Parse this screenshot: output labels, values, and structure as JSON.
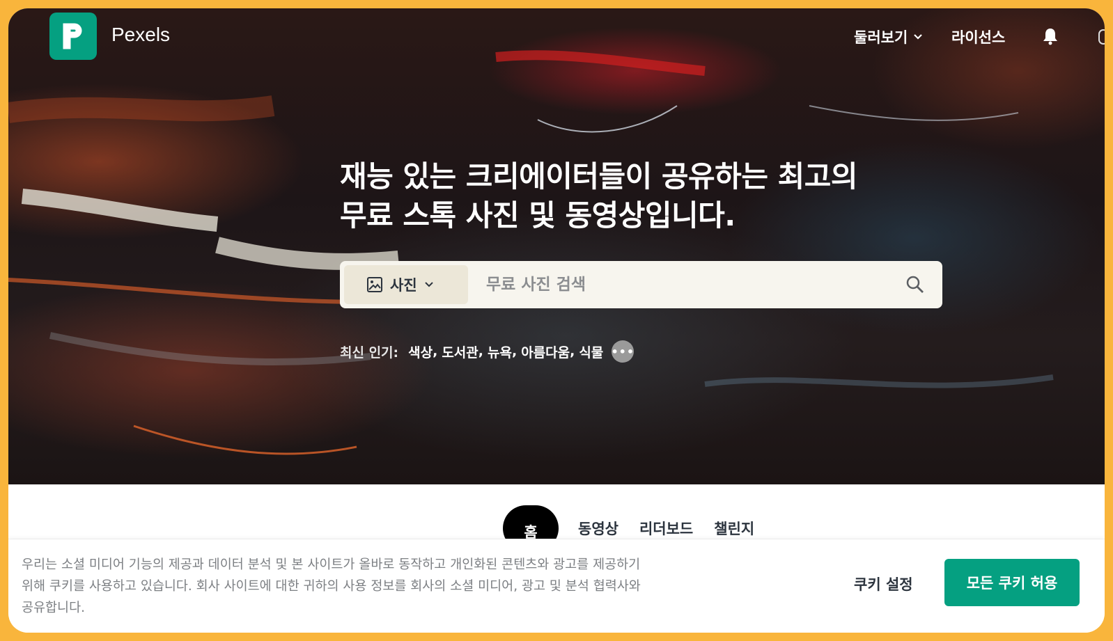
{
  "brand": {
    "name": "Pexels",
    "color": "#05a081"
  },
  "nav": {
    "explore_label": "둘러보기",
    "license_label": "라이선스",
    "icons": [
      "chevron-down-icon",
      "bell-icon"
    ]
  },
  "hero": {
    "headline_line1": "재능 있는 크리에이터들이 공유하는 최고의",
    "headline_line2": "무료 스톡 사진 및 동영상입니다."
  },
  "search": {
    "type_label": "사진",
    "placeholder": "무료 사진 검색",
    "value": ""
  },
  "trending": {
    "label": "최신 인기:",
    "items": [
      "색상",
      "도서관",
      "뉴욕",
      "아름다움",
      "식물"
    ],
    "more_label": "•••"
  },
  "tabs": [
    {
      "label": "홈",
      "active": true
    },
    {
      "label": "동영상",
      "active": false
    },
    {
      "label": "리더보드",
      "active": false
    },
    {
      "label": "챌린지",
      "active": false
    }
  ],
  "cookie_banner": {
    "text": "우리는 소셜 미디어 기능의 제공과 데이터 분석 및 본 사이트가 올바로 동작하고 개인화된 콘텐츠와 광고를 제공하기 위해 쿠키를 사용하고 있습니다. 회사 사이트에 대한 귀하의 사용 정보를 회사의 소셜 미디어, 광고 및 분석 협력사와 공유합니다.",
    "settings_label": "쿠키 설정",
    "accept_label": "모든 쿠키 허용"
  }
}
